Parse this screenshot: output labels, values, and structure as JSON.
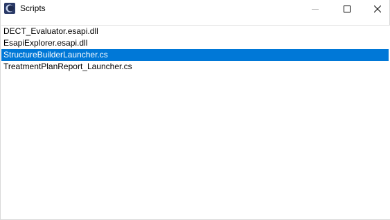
{
  "window": {
    "title": "Scripts"
  },
  "icons": {
    "app": "eclipse-app-icon",
    "minimize": "minimize-icon",
    "maximize": "maximize-icon",
    "close": "close-icon"
  },
  "colors": {
    "selection": "#0078d7",
    "selection_text": "#ffffff"
  },
  "list": {
    "items": [
      {
        "label": "DECT_Evaluator.esapi.dll",
        "selected": false
      },
      {
        "label": "EsapiExplorer.esapi.dll",
        "selected": false
      },
      {
        "label": "StructureBuilderLauncher.cs",
        "selected": true
      },
      {
        "label": "TreatmentPlanReport_Launcher.cs",
        "selected": false
      }
    ]
  }
}
